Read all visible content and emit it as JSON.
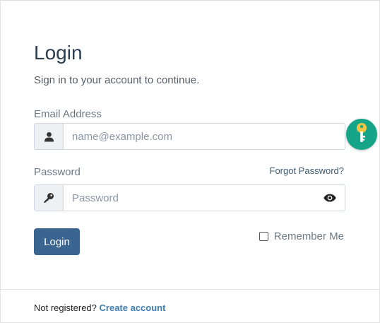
{
  "form": {
    "title": "Login",
    "subtitle": "Sign in to your account to continue.",
    "email": {
      "label": "Email Address",
      "placeholder": "name@example.com",
      "value": "",
      "icon": "user-icon"
    },
    "password": {
      "label": "Password",
      "placeholder": "Password",
      "value": "",
      "icon": "key-icon",
      "toggle_icon": "eye-icon",
      "forgot_label": "Forgot Password?"
    },
    "submit_label": "Login",
    "remember_label": "Remember Me",
    "remember_checked": false
  },
  "footer": {
    "prompt": "Not registered?",
    "link_label": "Create account"
  },
  "floating_button": {
    "icon": "key-icon",
    "color": "#17a589"
  },
  "colors": {
    "primary": "#3a6590",
    "link": "#3e7cb1",
    "accent": "#17a589",
    "key": "#f4c542"
  }
}
